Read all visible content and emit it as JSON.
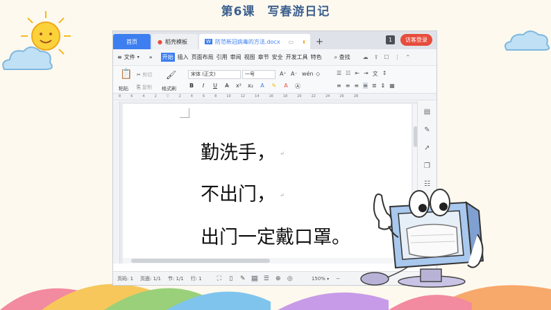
{
  "slide": {
    "title": "第6课　写春游日记"
  },
  "window": {
    "tabs": [
      {
        "label": "首页"
      },
      {
        "label": "稻壳模板"
      },
      {
        "label": "防范新冠病毒的方法.docx"
      }
    ],
    "tab_badge": "1",
    "login_label": "访客登录"
  },
  "menubar": {
    "file_label": "文件",
    "more": "»",
    "items": [
      "开始",
      "插入",
      "页面布局",
      "引用",
      "审阅",
      "视图",
      "章节",
      "安全",
      "开发工具",
      "特色"
    ],
    "search_label": "查找"
  },
  "ribbon": {
    "paste_label": "粘贴",
    "cut_label": "剪切",
    "copy_label": "复制",
    "format_painter_label": "格式刷",
    "font_name": "宋体 (正文)",
    "font_size": "一号",
    "bold": "B",
    "italic": "I",
    "underline": "U"
  },
  "document": {
    "lines": [
      "勤洗手，",
      "不出门，",
      "出门一定戴口罩。"
    ],
    "para_mark": "↵"
  },
  "statusbar": {
    "page_num": "页码: 1",
    "page": "页面: 1/1",
    "section": "节: 1/1",
    "row": "行: 1",
    "zoom": "150%"
  },
  "colors": {
    "accent": "#3d7ff0",
    "login": "#e74c3c",
    "title": "#3b5f8f"
  }
}
